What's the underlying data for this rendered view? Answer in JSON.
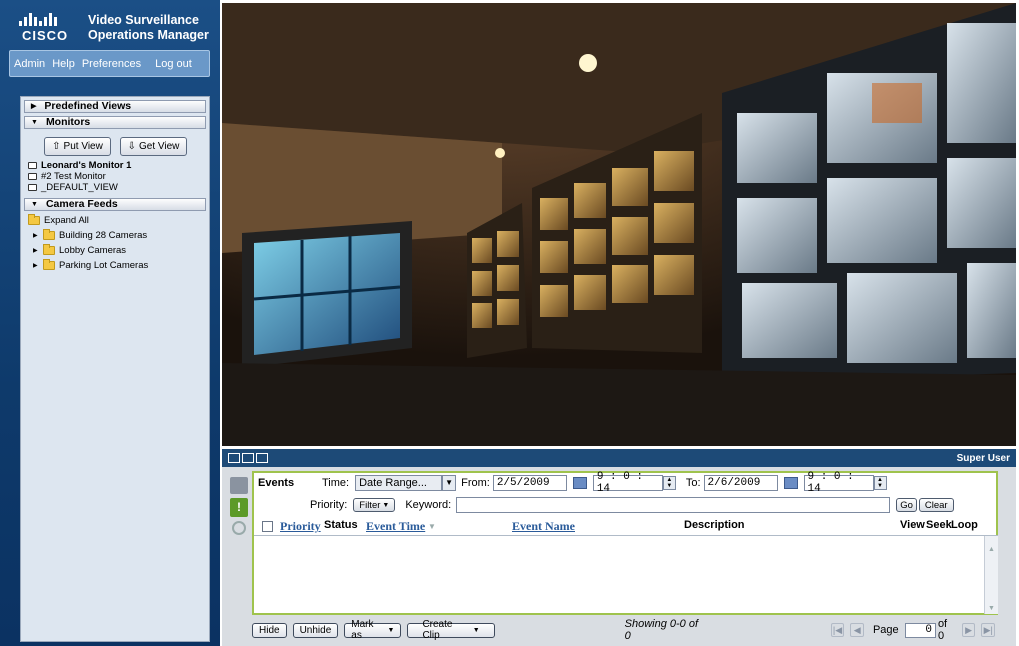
{
  "brand": {
    "logo_text": "CISCO",
    "product_line1": "Video Surveillance",
    "product_line2": "Operations Manager"
  },
  "nav": {
    "admin": "Admin",
    "help": "Help",
    "preferences": "Preferences",
    "logout": "Log out"
  },
  "tree": {
    "predefined_views": "Predefined Views",
    "monitors": "Monitors",
    "put_view": "Put View",
    "get_view": "Get View",
    "monitor_items": [
      "Leonard's Monitor 1",
      "#2 Test Monitor",
      "_DEFAULT_VIEW"
    ],
    "camera_feeds": "Camera Feeds",
    "expand_all": "Expand All",
    "folders": [
      "Building 28 Cameras",
      "Lobby Cameras",
      "Parking Lot Cameras"
    ]
  },
  "events": {
    "user": "Super User",
    "title": "Events",
    "time_label": "Time:",
    "time_value": "Date Range...",
    "from_label": "From:",
    "from_date": "2/5/2009",
    "from_time": "9 : 0 : 14",
    "to_label": "To:",
    "to_date": "2/6/2009",
    "to_time": "9 : 0 : 14",
    "priority_label": "Priority:",
    "filter_label": "Filter",
    "keyword_label": "Keyword:",
    "keyword_value": "",
    "go_label": "Go",
    "clear_label": "Clear",
    "columns": {
      "priority": "Priority",
      "status": "Status",
      "event_time": "Event Time",
      "event_name": "Event Name",
      "description": "Description",
      "view": "View",
      "seek": "Seek",
      "loop": "Loop"
    },
    "hide": "Hide",
    "unhide": "Unhide",
    "mark_as": "Mark as",
    "create_clip": "Create Clip",
    "showing": "Showing 0-0 of 0",
    "page_label": "Page",
    "page_value": "0",
    "of_label": "of 0"
  },
  "colors": {
    "sidebar": "#0e3a6b",
    "accent_green": "#9fc34d",
    "link": "#2a5b9a"
  }
}
